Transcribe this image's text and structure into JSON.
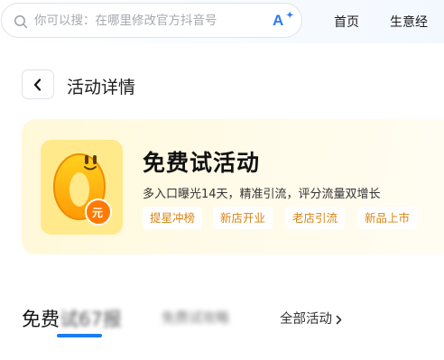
{
  "topbar": {
    "search_placeholder": "你可以搜：在哪里修改官方抖音号",
    "search_icon": "search-icon",
    "ai_icon": "ai-search-icon",
    "nav": [
      {
        "label": "首页"
      },
      {
        "label": "生意经"
      }
    ]
  },
  "header": {
    "back_icon": "chevron-left-icon",
    "title": "活动详情"
  },
  "banner": {
    "logo_icon": "free-trial-logo-icon",
    "logo_badge": "元",
    "title": "免费试活动",
    "subtitle": "多入口曝光14天，精准引流，评分流量双增长",
    "tags": [
      {
        "label": "提星冲榜"
      },
      {
        "label": "新店开业"
      },
      {
        "label": "老店引流"
      },
      {
        "label": "新品上市"
      }
    ]
  },
  "tabs": {
    "active": {
      "visible": "免费",
      "blurred": "试67报"
    },
    "second": {
      "blurred": "免费试攻略"
    },
    "all": {
      "label": "全部活动"
    }
  },
  "colors": {
    "accent": "#1a7cf3",
    "tag_text": "#d88412",
    "banner_bg": "#fff8d8"
  }
}
